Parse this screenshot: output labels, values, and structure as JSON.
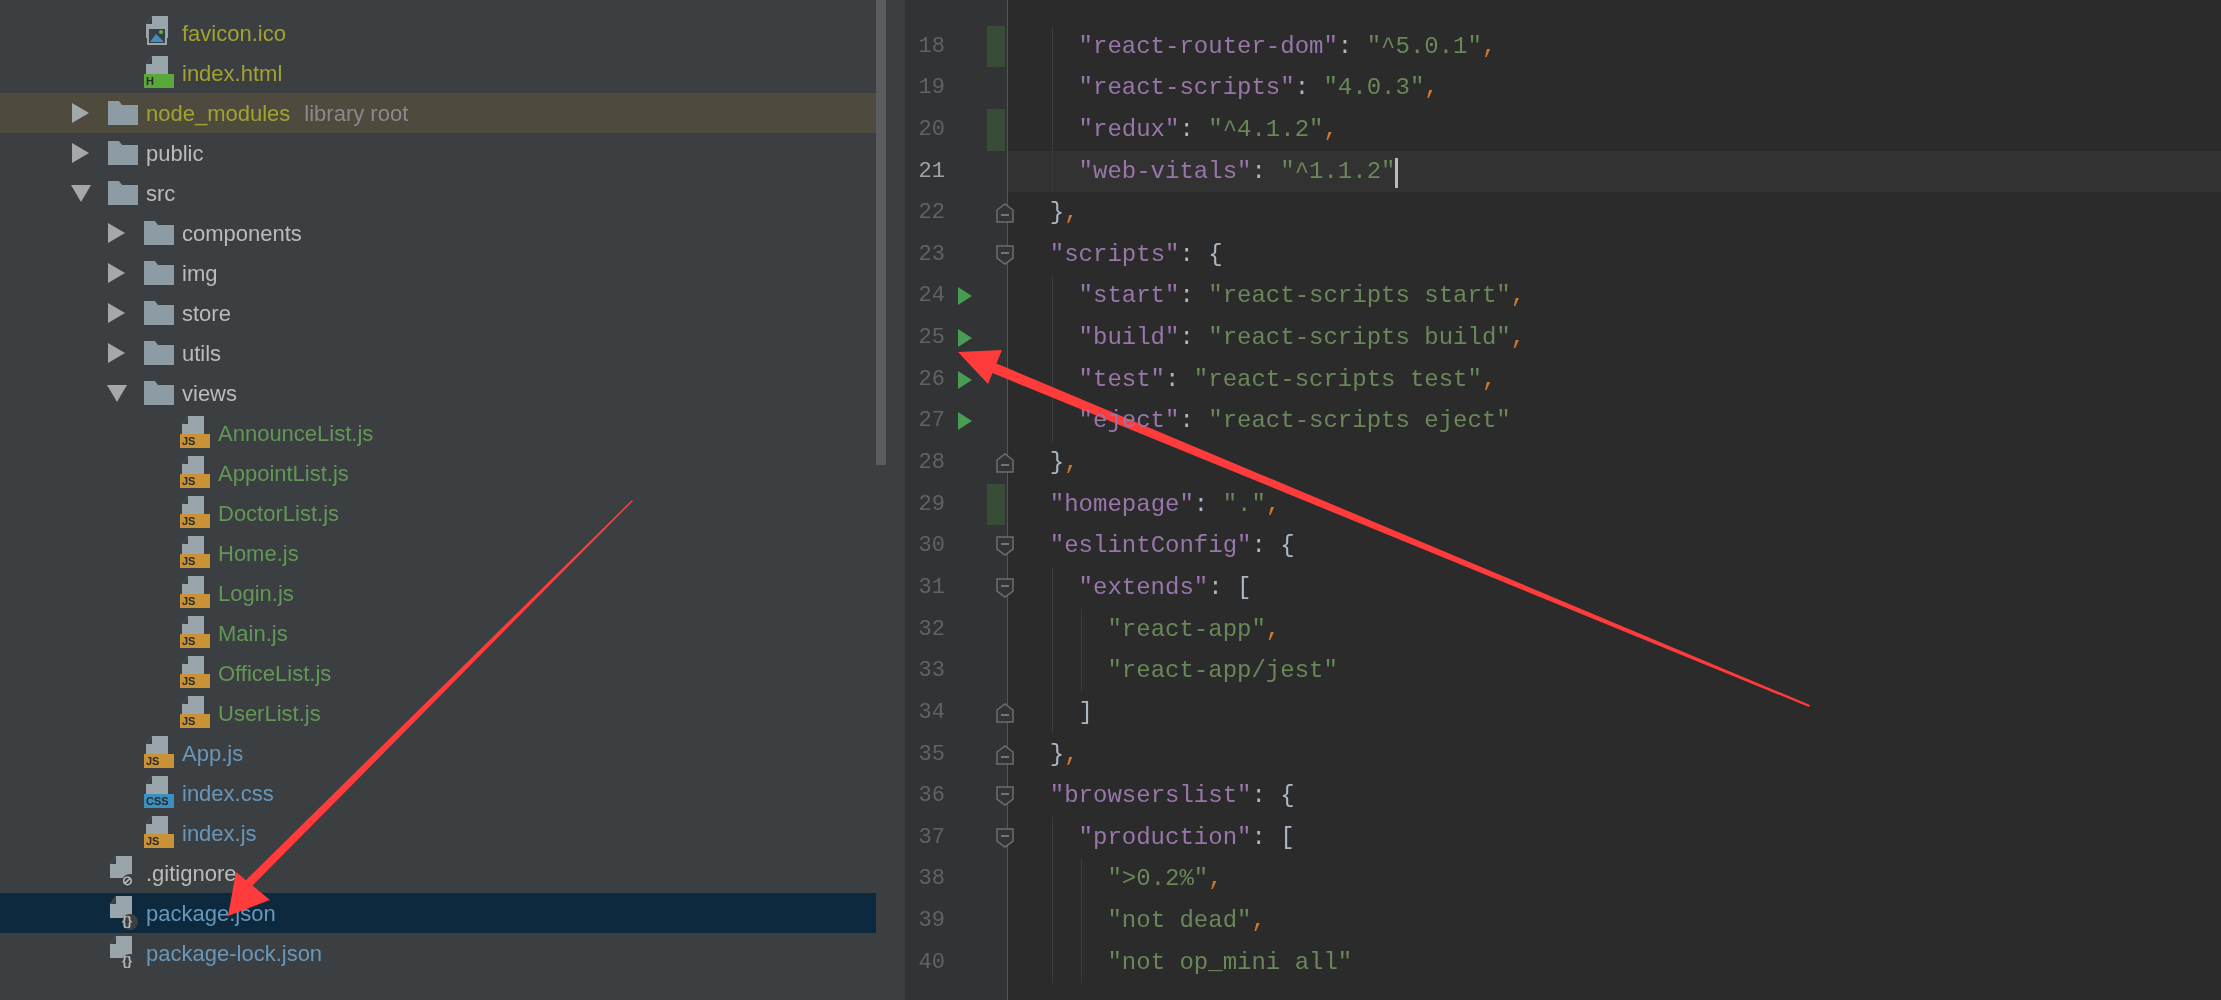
{
  "project_tree": {
    "scrolled_parent_children": [
      {
        "name": "favicon.ico",
        "kind": "ico",
        "color": "#a2a32e",
        "selected": false
      },
      {
        "name": "index.html",
        "kind": "html",
        "badge": "H",
        "color": "#a2a32e",
        "selected": false
      }
    ],
    "items": [
      {
        "name": "node_modules",
        "kind": "folder",
        "suffix": "library root",
        "highlighted": true,
        "expanded": false,
        "color": "#a2a32e",
        "selected": false
      },
      {
        "name": "public",
        "kind": "folder",
        "expanded": false,
        "color": "#bbbbbb",
        "selected": false
      },
      {
        "name": "src",
        "kind": "folder",
        "expanded": true,
        "color": "#bbbbbb",
        "selected": false,
        "children": [
          {
            "name": "components",
            "kind": "folder",
            "expanded": false,
            "color": "#bbbbbb",
            "selected": false
          },
          {
            "name": "img",
            "kind": "folder",
            "expanded": false,
            "color": "#bbbbbb",
            "selected": false
          },
          {
            "name": "store",
            "kind": "folder",
            "expanded": false,
            "color": "#bbbbbb",
            "selected": false
          },
          {
            "name": "utils",
            "kind": "folder",
            "expanded": false,
            "color": "#bbbbbb",
            "selected": false
          },
          {
            "name": "views",
            "kind": "folder",
            "expanded": true,
            "color": "#bbbbbb",
            "selected": false,
            "children": [
              {
                "name": "AnnounceList.js",
                "kind": "js",
                "badge": "JS",
                "color": "#629755",
                "selected": false
              },
              {
                "name": "AppointList.js",
                "kind": "js",
                "badge": "JS",
                "color": "#629755",
                "selected": false
              },
              {
                "name": "DoctorList.js",
                "kind": "js",
                "badge": "JS",
                "color": "#629755",
                "selected": false
              },
              {
                "name": "Home.js",
                "kind": "js",
                "badge": "JS",
                "color": "#629755",
                "selected": false
              },
              {
                "name": "Login.js",
                "kind": "js",
                "badge": "JS",
                "color": "#629755",
                "selected": false
              },
              {
                "name": "Main.js",
                "kind": "js",
                "badge": "JS",
                "color": "#629755",
                "selected": false
              },
              {
                "name": "OfficeList.js",
                "kind": "js",
                "badge": "JS",
                "color": "#629755",
                "selected": false
              },
              {
                "name": "UserList.js",
                "kind": "js",
                "badge": "JS",
                "color": "#629755",
                "selected": false
              }
            ]
          },
          {
            "name": "App.js",
            "kind": "js",
            "badge": "JS",
            "color": "#6897bb",
            "selected": false
          },
          {
            "name": "index.css",
            "kind": "css",
            "badge": "CSS",
            "color": "#6897bb",
            "selected": false
          },
          {
            "name": "index.js",
            "kind": "js",
            "badge": "JS",
            "color": "#6897bb",
            "selected": false
          }
        ]
      },
      {
        "name": ".gitignore",
        "kind": "gitignore",
        "badge": "⊘",
        "color": "#bbbbbb",
        "selected": false
      },
      {
        "name": "package.json",
        "kind": "json",
        "badge": "{}",
        "color": "#6897bb",
        "selected": true
      },
      {
        "name": "package-lock.json",
        "kind": "json",
        "badge": "{}",
        "color": "#6897bb",
        "selected": false
      }
    ]
  },
  "editor": {
    "lines": [
      {
        "number": "18",
        "text": "    \"react-router-dom\": \"^5.0.1\",",
        "changed": true
      },
      {
        "number": "19",
        "text": "    \"react-scripts\": \"4.0.3\","
      },
      {
        "number": "20",
        "text": "    \"redux\": \"^4.1.2\",",
        "changed": true
      },
      {
        "number": "21",
        "text": "    \"web-vitals\": \"^1.1.2\"",
        "current": true
      },
      {
        "number": "22",
        "text": "  },",
        "fold_end": true
      },
      {
        "number": "23",
        "text": "  \"scripts\": {",
        "fold_start": true
      },
      {
        "number": "24",
        "text": "    \"start\": \"react-scripts start\",",
        "runnable": true
      },
      {
        "number": "25",
        "text": "    \"build\": \"react-scripts build\",",
        "runnable": true
      },
      {
        "number": "26",
        "text": "    \"test\": \"react-scripts test\",",
        "runnable": true
      },
      {
        "number": "27",
        "text": "    \"eject\": \"react-scripts eject\"",
        "runnable": true
      },
      {
        "number": "28",
        "text": "  },",
        "fold_end": true
      },
      {
        "number": "29",
        "text": "  \"homepage\": \".\",",
        "changed": true
      },
      {
        "number": "30",
        "text": "  \"eslintConfig\": {",
        "fold_start": true
      },
      {
        "number": "31",
        "text": "    \"extends\": [",
        "fold_start": true
      },
      {
        "number": "32",
        "text": "      \"react-app\","
      },
      {
        "number": "33",
        "text": "      \"react-app/jest\""
      },
      {
        "number": "34",
        "text": "    ]",
        "fold_end": true
      },
      {
        "number": "35",
        "text": "  },",
        "fold_end": true
      },
      {
        "number": "36",
        "text": "  \"browserslist\": {",
        "fold_start": true
      },
      {
        "number": "37",
        "text": "    \"production\": [",
        "fold_start": true
      },
      {
        "number": "38",
        "text": "      \">0.2%\","
      },
      {
        "number": "39",
        "text": "      \"not dead\","
      },
      {
        "number": "40",
        "text": "      \"not op_mini all\""
      }
    ]
  }
}
